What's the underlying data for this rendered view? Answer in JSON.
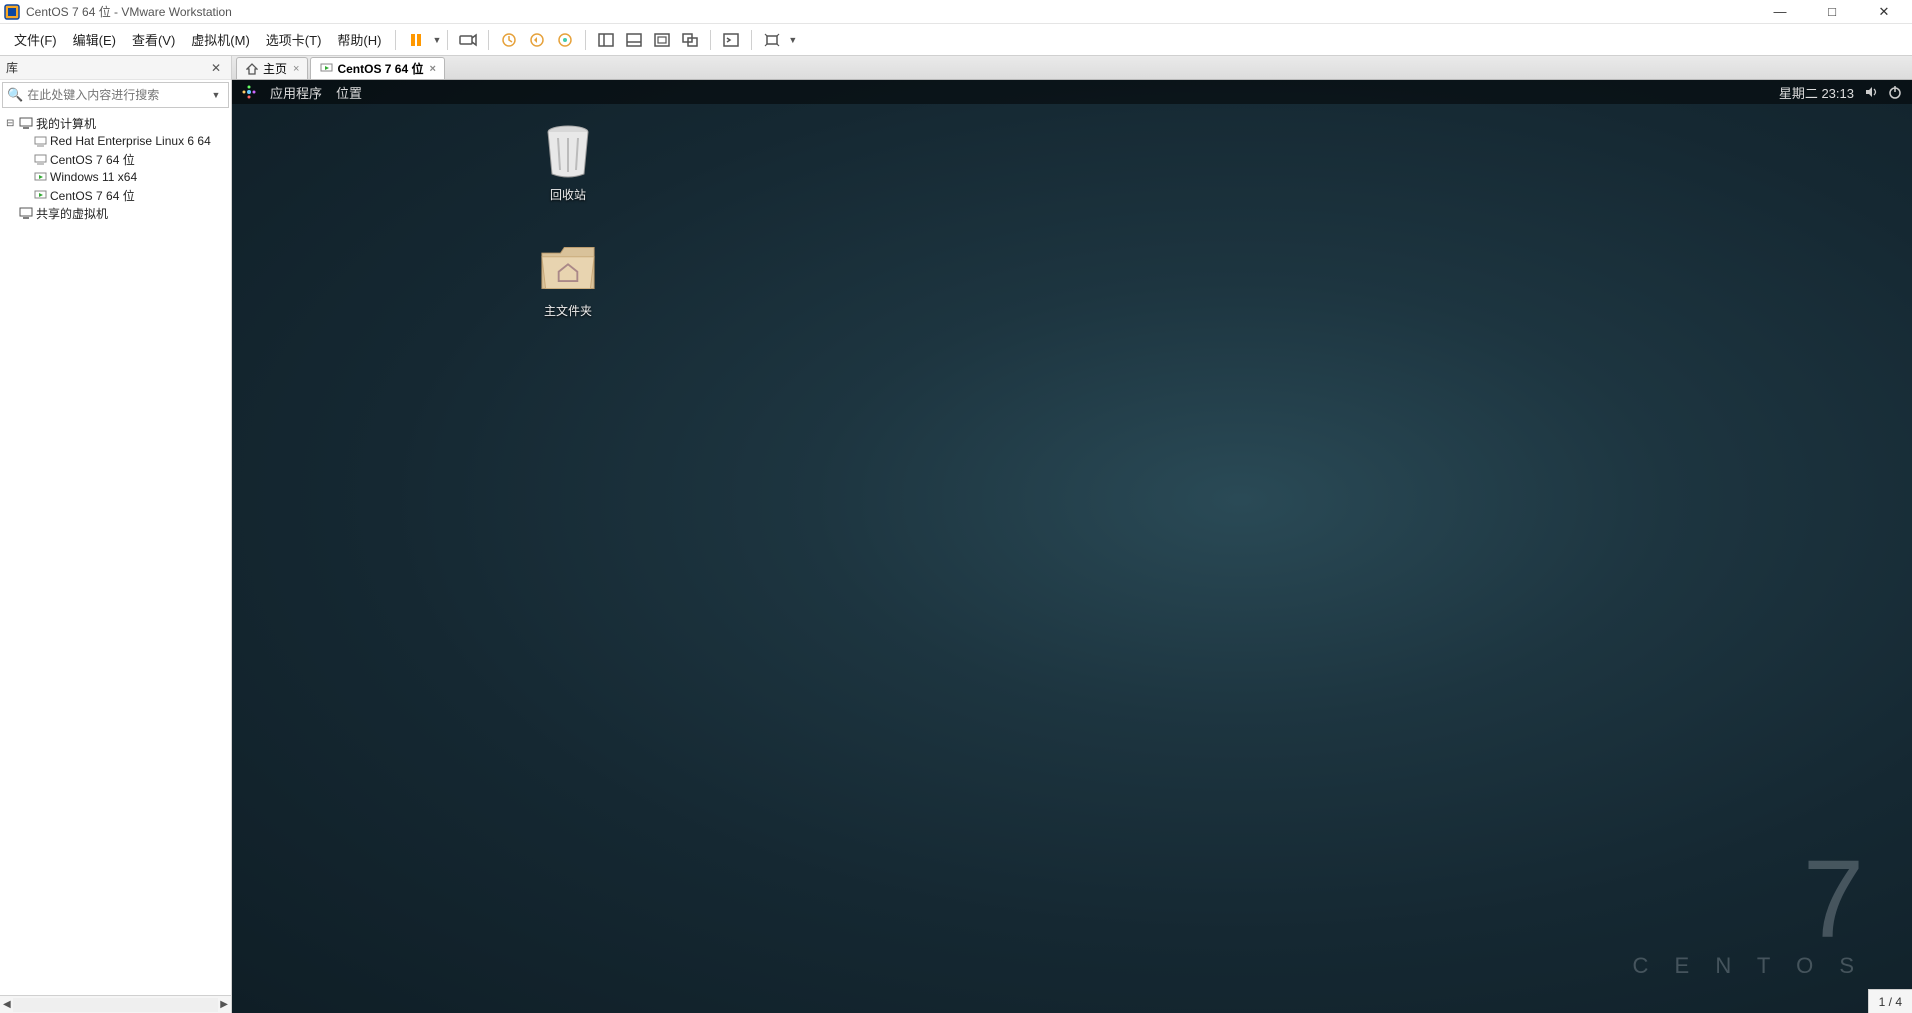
{
  "titlebar": {
    "title": "CentOS 7 64 位 - VMware Workstation"
  },
  "menu": {
    "items": [
      "文件(F)",
      "编辑(E)",
      "查看(V)",
      "虚拟机(M)",
      "选项卡(T)",
      "帮助(H)"
    ]
  },
  "sidebar": {
    "header": "库",
    "search_placeholder": "在此处键入内容进行搜索",
    "tree": {
      "root1": "我的计算机",
      "children": [
        "Red Hat Enterprise Linux 6 64",
        "CentOS 7 64 位",
        "Windows 11 x64",
        "CentOS 7 64 位"
      ],
      "root2": "共享的虚拟机"
    }
  },
  "tabs": {
    "home": "主页",
    "active": "CentOS 7 64 位"
  },
  "gnome": {
    "apps": "应用程序",
    "places": "位置",
    "clock": "星期二 23:13"
  },
  "desktop": {
    "trash": "回收站",
    "home": "主文件夹"
  },
  "brand": {
    "num": "7",
    "name": "C E N T O S"
  },
  "status": {
    "page": "1 / 4"
  }
}
